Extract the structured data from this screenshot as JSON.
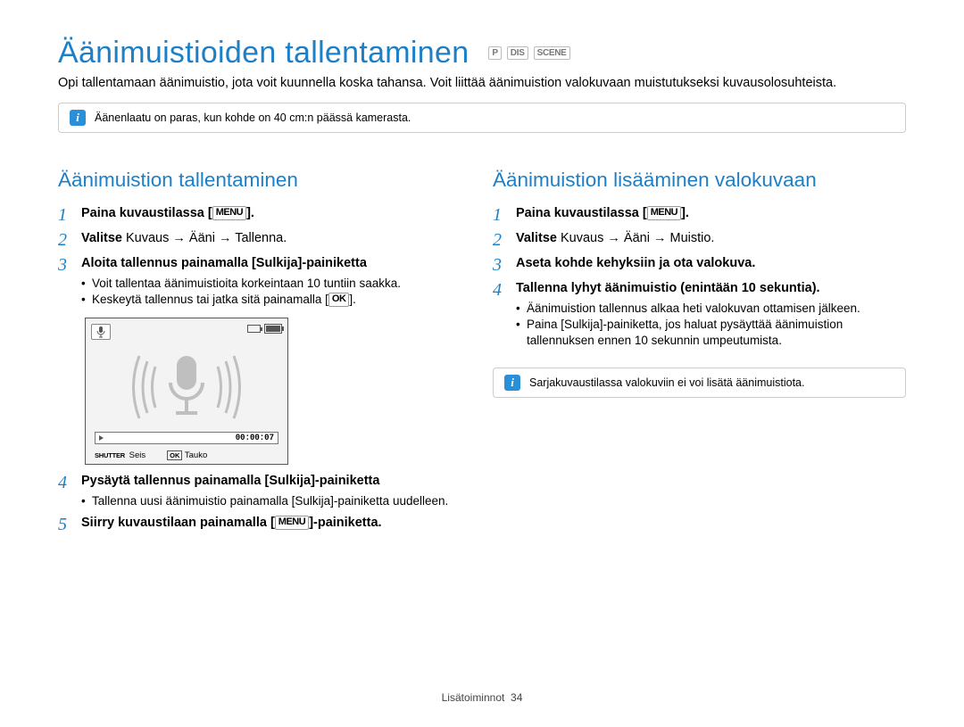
{
  "page": {
    "title": "Äänimuistioiden tallentaminen",
    "intro": "Opi tallentamaan äänimuistio, jota voit kuunnella koska tahansa. Voit liittää äänimuistion valokuvaan muistutukseksi kuvausolosuhteista.",
    "mode_icons": [
      "P",
      "DIS",
      "SCENE"
    ]
  },
  "top_note": {
    "text": "Äänenlaatu on paras, kun kohde on 40 cm:n päässä kamerasta."
  },
  "labels": {
    "menu": "MENU",
    "ok": "OK",
    "shutter": "SHUTTER"
  },
  "left": {
    "heading": "Äänimuistion tallentaminen",
    "steps": [
      {
        "n": "1",
        "bold1": "Paina kuvaustilassa [",
        "btn": "MENU",
        "bold2": "]."
      },
      {
        "n": "2",
        "bold": "Valitse ",
        "plain": "Kuvaus → Ääni → Tallenna",
        "tail": "."
      },
      {
        "n": "3",
        "bold": "Aloita tallennus painamalla [",
        "plain_btn": "Sulkija",
        "bold2": "]-painiketta",
        "plain_tail": "",
        "bullets": [
          {
            "t": "Voit tallentaa äänimuistioita korkeintaan 10 tuntiin saakka."
          },
          {
            "t1": "Keskeytä tallennus tai jatka sitä painamalla [",
            "btn": "OK",
            "t2": "]."
          }
        ]
      },
      {
        "n": "4",
        "bold": "Pysäytä tallennus painamalla [",
        "plain_btn": "Sulkija",
        "bold2": "]-painiketta",
        "plain_tail": "",
        "bullets": [
          {
            "t": "Tallenna uusi äänimuistio painamalla [Sulkija]-painiketta uudelleen."
          }
        ]
      },
      {
        "n": "5",
        "bold1": "Siirry kuvaustilaan painamalla [",
        "btn": "MENU",
        "bold2": "]-painiketta."
      }
    ]
  },
  "recorder": {
    "time": "00:00:07",
    "foot_l_label": "SHUTTER",
    "foot_l_text": "Seis",
    "foot_r_label": "OK",
    "foot_r_text": "Tauko"
  },
  "right": {
    "heading": "Äänimuistion lisääminen valokuvaan",
    "steps": [
      {
        "n": "1",
        "bold1": "Paina kuvaustilassa [",
        "btn": "MENU",
        "bold2": "]."
      },
      {
        "n": "2",
        "bold": "Valitse ",
        "plain": "Kuvaus → Ääni → Muistio",
        "tail": "."
      },
      {
        "n": "3",
        "bold": "Aseta kohde kehyksiin ja ota valokuva."
      },
      {
        "n": "4",
        "bold": "Tallenna lyhyt äänimuistio (enintään 10 sekuntia).",
        "bullets": [
          {
            "t": "Äänimuistion tallennus alkaa heti valokuvan ottamisen jälkeen."
          },
          {
            "t": "Paina [Sulkija]-painiketta, jos haluat pysäyttää äänimuistion tallennuksen ennen 10 sekunnin umpeutumista."
          }
        ]
      }
    ],
    "note": {
      "text": "Sarjakuvaustilassa valokuviin ei voi lisätä äänimuistiota."
    }
  },
  "footer": {
    "section": "Lisätoiminnot",
    "page": "34"
  }
}
